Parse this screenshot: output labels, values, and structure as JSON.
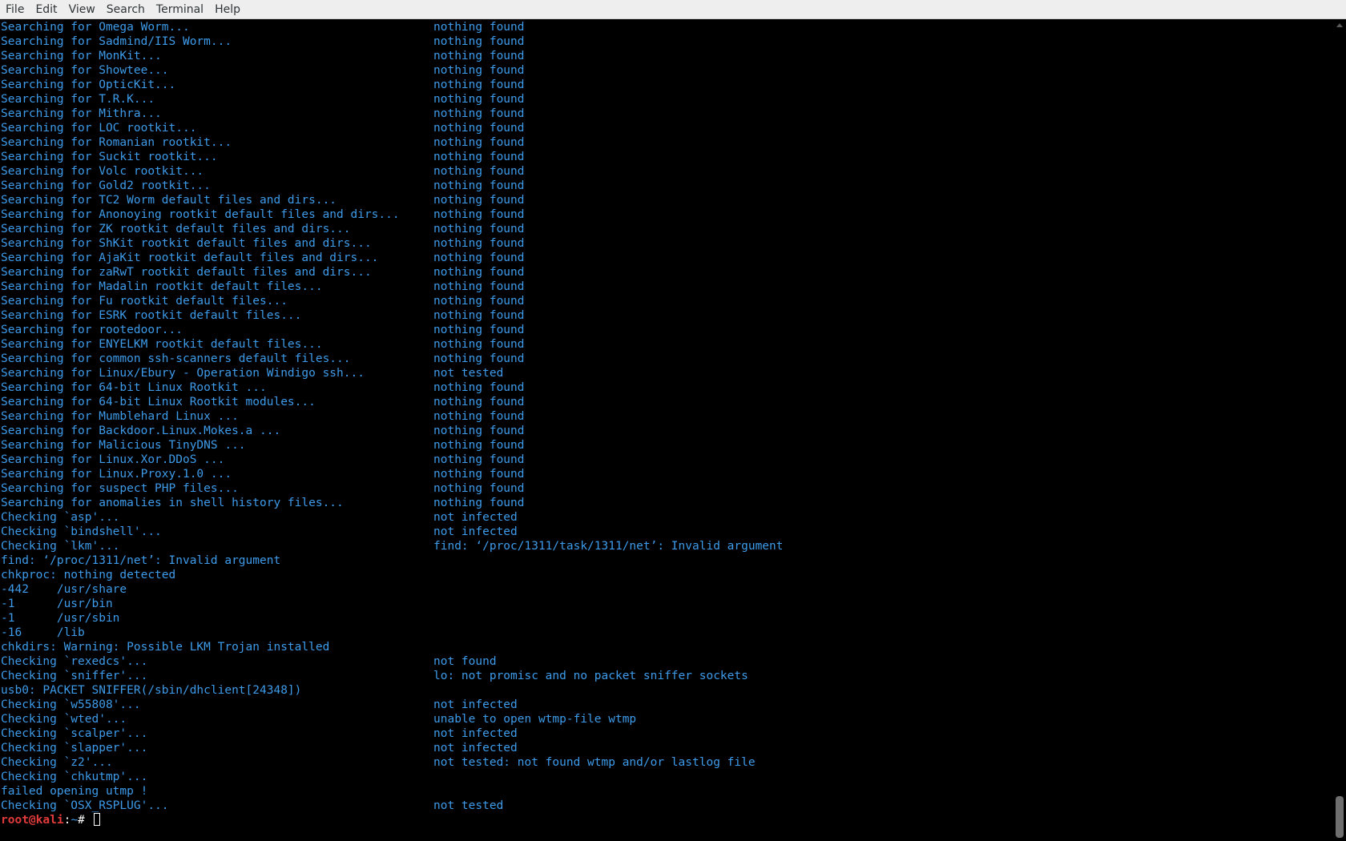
{
  "menubar": {
    "items": [
      "File",
      "Edit",
      "View",
      "Search",
      "Terminal",
      "Help"
    ]
  },
  "terminal": {
    "lines": [
      {
        "left": "Searching for Omega Worm...",
        "right": "nothing found"
      },
      {
        "left": "Searching for Sadmind/IIS Worm...",
        "right": "nothing found"
      },
      {
        "left": "Searching for MonKit...",
        "right": "nothing found"
      },
      {
        "left": "Searching for Showtee...",
        "right": "nothing found"
      },
      {
        "left": "Searching for OpticKit...",
        "right": "nothing found"
      },
      {
        "left": "Searching for T.R.K...",
        "right": "nothing found"
      },
      {
        "left": "Searching for Mithra...",
        "right": "nothing found"
      },
      {
        "left": "Searching for LOC rootkit...",
        "right": "nothing found"
      },
      {
        "left": "Searching for Romanian rootkit...",
        "right": "nothing found"
      },
      {
        "left": "Searching for Suckit rootkit...",
        "right": "nothing found"
      },
      {
        "left": "Searching for Volc rootkit...",
        "right": "nothing found"
      },
      {
        "left": "Searching for Gold2 rootkit...",
        "right": "nothing found"
      },
      {
        "left": "Searching for TC2 Worm default files and dirs...",
        "right": "nothing found"
      },
      {
        "left": "Searching for Anonoying rootkit default files and dirs...",
        "right": "nothing found"
      },
      {
        "left": "Searching for ZK rootkit default files and dirs...",
        "right": "nothing found"
      },
      {
        "left": "Searching for ShKit rootkit default files and dirs...",
        "right": "nothing found"
      },
      {
        "left": "Searching for AjaKit rootkit default files and dirs...",
        "right": "nothing found"
      },
      {
        "left": "Searching for zaRwT rootkit default files and dirs...",
        "right": "nothing found"
      },
      {
        "left": "Searching for Madalin rootkit default files...",
        "right": "nothing found"
      },
      {
        "left": "Searching for Fu rootkit default files...",
        "right": "nothing found"
      },
      {
        "left": "Searching for ESRK rootkit default files...",
        "right": "nothing found"
      },
      {
        "left": "Searching for rootedoor...",
        "right": "nothing found"
      },
      {
        "left": "Searching for ENYELKM rootkit default files...",
        "right": "nothing found"
      },
      {
        "left": "Searching for common ssh-scanners default files...",
        "right": "nothing found"
      },
      {
        "left": "Searching for Linux/Ebury - Operation Windigo ssh...",
        "right": "not tested"
      },
      {
        "left": "Searching for 64-bit Linux Rootkit ...",
        "right": "nothing found"
      },
      {
        "left": "Searching for 64-bit Linux Rootkit modules...",
        "right": "nothing found"
      },
      {
        "left": "Searching for Mumblehard Linux ...",
        "right": "nothing found"
      },
      {
        "left": "Searching for Backdoor.Linux.Mokes.a ...",
        "right": "nothing found"
      },
      {
        "left": "Searching for Malicious TinyDNS ...",
        "right": "nothing found"
      },
      {
        "left": "Searching for Linux.Xor.DDoS ...",
        "right": "nothing found"
      },
      {
        "left": "Searching for Linux.Proxy.1.0 ...",
        "right": "nothing found"
      },
      {
        "left": "Searching for suspect PHP files...",
        "right": "nothing found"
      },
      {
        "left": "Searching for anomalies in shell history files...",
        "right": "nothing found"
      },
      {
        "left": "Checking `asp'...",
        "right": "not infected"
      },
      {
        "left": "Checking `bindshell'...",
        "right": "not infected"
      },
      {
        "left": "Checking `lkm'...",
        "right": "find: ‘/proc/1311/task/1311/net’: Invalid argument"
      },
      {
        "left": "find: ‘/proc/1311/net’: Invalid argument",
        "right": ""
      },
      {
        "left": "chkproc: nothing detected",
        "right": ""
      },
      {
        "left": "-442    /usr/share",
        "right": ""
      },
      {
        "left": "-1      /usr/bin",
        "right": ""
      },
      {
        "left": "-1      /usr/sbin",
        "right": ""
      },
      {
        "left": "-16     /lib",
        "right": ""
      },
      {
        "left": "chkdirs: Warning: Possible LKM Trojan installed",
        "right": ""
      },
      {
        "left": "Checking `rexedcs'...",
        "right": "not found"
      },
      {
        "left": "Checking `sniffer'...",
        "right": "lo: not promisc and no packet sniffer sockets"
      },
      {
        "left": "usb0: PACKET SNIFFER(/sbin/dhclient[24348])",
        "right": ""
      },
      {
        "left": "Checking `w55808'...",
        "right": "not infected"
      },
      {
        "left": "Checking `wted'...",
        "right": "unable to open wtmp-file wtmp"
      },
      {
        "left": "Checking `scalper'...",
        "right": "not infected"
      },
      {
        "left": "Checking `slapper'...",
        "right": "not infected"
      },
      {
        "left": "Checking `z2'...",
        "right": "not tested: not found wtmp and/or lastlog file"
      },
      {
        "left": "Checking `chkutmp'...",
        "right": ""
      },
      {
        "left": "failed opening utmp !",
        "right": ""
      },
      {
        "left": "Checking `OSX_RSPLUG'...",
        "right": "not tested"
      }
    ],
    "prompt": {
      "user_host": "root@kali",
      "separator": ":",
      "path": "~",
      "symbol": "# "
    }
  },
  "colors": {
    "text": "#3d9be9",
    "prompt_user": "#e33b3b",
    "background": "#000000",
    "menubar": "#eeeeee"
  }
}
